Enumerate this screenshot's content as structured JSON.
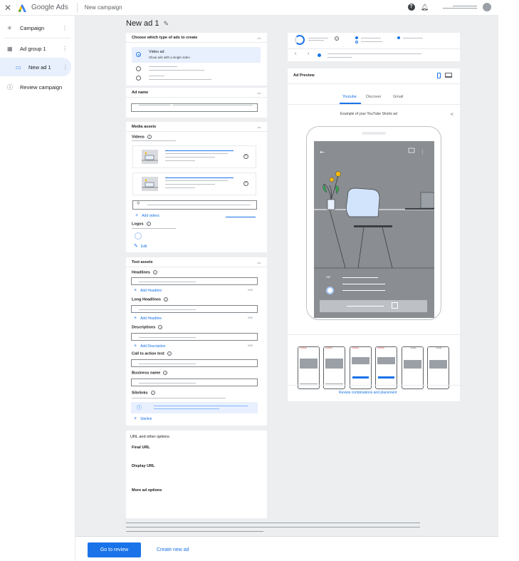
{
  "topbar": {
    "close_icon": "close-icon",
    "app_name": "Google Ads",
    "campaign_title": "New campaign",
    "help_label": "?",
    "icons": [
      "help-icon",
      "bell-icon",
      "avatar"
    ]
  },
  "sidebar": {
    "items": [
      {
        "label": "Campaign",
        "icon": "asterisk-icon"
      },
      {
        "label": "Ad group 1",
        "icon": "grid-icon"
      },
      {
        "label": "New ad 1",
        "icon": "ad-icon"
      },
      {
        "label": "Review campaign",
        "icon": "info-icon"
      }
    ]
  },
  "main": {
    "title": "New ad 1",
    "ad_type_card": {
      "header": "Choose which type of ads to create",
      "selected_title": "Video ad",
      "selected_subtitle": "Show ads with a single video"
    },
    "ad_name_card": {
      "header": "Ad name"
    },
    "media_card": {
      "header": "Media assets",
      "videos_label": "Videos",
      "add_videos": "Add videos",
      "logos_label": "Logos",
      "edit": "Edit"
    },
    "text_card": {
      "header": "Text assets",
      "headlines_label": "Headlines",
      "add_headline": "Add Headline",
      "headline_counter": "0/30",
      "long_headlines_label": "Long Headlines",
      "long_headline_counter": "0/90",
      "descriptions_label": "Descriptions",
      "add_description": "Add Description",
      "description_counter": "0/90",
      "cta_label": "Call to action text",
      "business_label": "Business name",
      "sitelinks_label": "Sitelinks",
      "add_sitelink": "Sitelink"
    },
    "url_card": {
      "header": "URL and other options",
      "final_url": "Final URL",
      "display_url": "Display URL",
      "more_options": "More ad options"
    }
  },
  "preview": {
    "title": "Ad Preview",
    "tabs": [
      "Youtube",
      "Discover",
      "Gmail"
    ],
    "active_tab": "Youtube",
    "caption": "Example of your YouTube Shorts ad",
    "ad_badge": "Ad",
    "review_link": "Review combinations and placement",
    "mini_labels": [
      "YouTube",
      "YouTube",
      "YouTube",
      "YouTube",
      "Google",
      "Google"
    ]
  },
  "bottom": {
    "primary_button": "Go to review",
    "secondary_button": "Create new ad"
  },
  "colors": {
    "accent": "#1a73e8",
    "background": "#eceef0",
    "selected_bg": "#e8f0fe"
  }
}
